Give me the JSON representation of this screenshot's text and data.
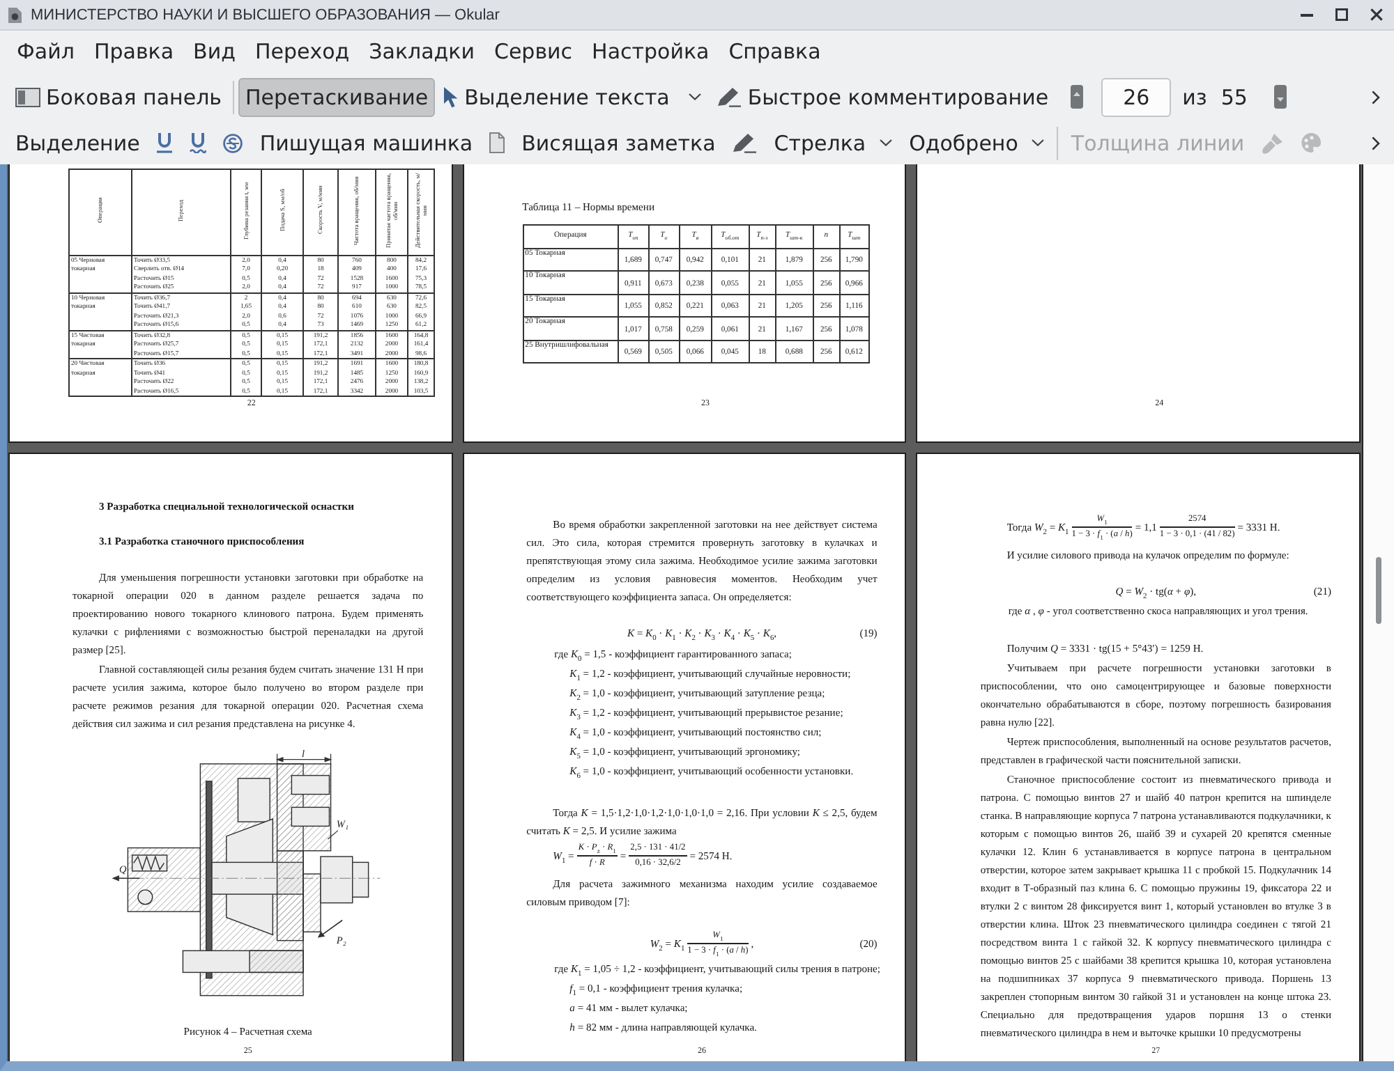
{
  "window": {
    "title": "МИНИСТЕРСТВО НАУКИ И ВЫСШЕГО ОБРАЗОВАНИЯ — Okular"
  },
  "menu": [
    "Файл",
    "Правка",
    "Вид",
    "Переход",
    "Закладки",
    "Сервис",
    "Настройка",
    "Справка"
  ],
  "main_toolbar": {
    "items": [
      {
        "kind": "icon-text",
        "label": "Боковая панель",
        "selected": false
      },
      {
        "kind": "separator"
      },
      {
        "kind": "text",
        "label": "Перетаскивание",
        "selected": true
      },
      {
        "kind": "icon-dropdown",
        "label": "Выделение текста",
        "selected": false
      },
      {
        "kind": "icon-text",
        "label": "Быстрое комментирование",
        "selected": false
      }
    ],
    "page_field": {
      "value": "26"
    },
    "page_of": "из",
    "page_total": "55"
  },
  "annotation_toolbar": {
    "items": [
      {
        "kind": "text",
        "label": "Выделение",
        "disabled": false
      },
      {
        "kind": "icon",
        "disabled": false
      },
      {
        "kind": "icon",
        "disabled": false
      },
      {
        "kind": "icon",
        "disabled": false
      },
      {
        "kind": "text",
        "label": "Пишущая машинка",
        "disabled": false
      },
      {
        "kind": "icon",
        "disabled": false
      },
      {
        "kind": "text",
        "label": "Висящая заметка",
        "disabled": false
      },
      {
        "kind": "icon",
        "disabled": false
      },
      {
        "kind": "dropdown",
        "label": "Стрелка",
        "disabled": false
      },
      {
        "kind": "dropdown",
        "label": "Одобрено",
        "disabled": false
      },
      {
        "kind": "separator"
      },
      {
        "kind": "text",
        "label": "Толщина линии",
        "disabled": true
      },
      {
        "kind": "icon",
        "disabled": true
      },
      {
        "kind": "icon",
        "disabled": true
      }
    ]
  },
  "pages": [
    {
      "number": "22",
      "blocks": [
        {
          "kind": "rotated-table",
          "columns": [
            "Операция",
            "Переход",
            "Глубина резания t, мм",
            "Подача S, мм/об",
            "Скорость V, м/мин",
            "Частота вращения, об/мин",
            "Принятая частота вращения, об/мин",
            "Действительная скорость, м/мин"
          ],
          "rows": [
            {
              "cells": [
                [
                  "05 Черновая токарная"
                ],
                [
                  "Точить Ø33,5",
                  "Сверлить отв. Ø14",
                  "Расточить Ø15",
                  "Расточить Ø25"
                ],
                [
                  "2,0",
                  "7,0",
                  "0,5",
                  "2,0"
                ],
                [
                  "0,4",
                  "0,20",
                  "0,4",
                  "0,4"
                ],
                [
                  "80",
                  "18",
                  "72",
                  "72"
                ],
                [
                  "760",
                  "409",
                  "1528",
                  "917"
                ],
                [
                  "800",
                  "400",
                  "1600",
                  "1000"
                ],
                [
                  "84,2",
                  "17,6",
                  "75,3",
                  "78,5"
                ]
              ]
            },
            {
              "cells": [
                [
                  "10 Черновая токарная"
                ],
                [
                  "Точить Ø36,7",
                  "Точить Ø41,7",
                  "Расточить Ø21,3",
                  "Расточить Ø15,6"
                ],
                [
                  "2",
                  "1,65",
                  "2,0",
                  "0,5"
                ],
                [
                  "0,4",
                  "0,4",
                  "0,6",
                  "0,4"
                ],
                [
                  "80",
                  "80",
                  "72",
                  "73"
                ],
                [
                  "694",
                  "610",
                  "1076",
                  "1469"
                ],
                [
                  "630",
                  "630",
                  "1000",
                  "1250"
                ],
                [
                  "72,6",
                  "82,5",
                  "66,9",
                  "61,2"
                ]
              ]
            },
            {
              "cells": [
                [
                  "15 Чистовая токарная"
                ],
                [
                  "Точить Ø32,8",
                  "Расточить Ø25,7",
                  "Расточить Ø15,7"
                ],
                [
                  "0,5",
                  "0,5",
                  "0,5"
                ],
                [
                  "0,15",
                  "0,15",
                  "0,15"
                ],
                [
                  "191,2",
                  "172,1",
                  "172,1"
                ],
                [
                  "1856",
                  "2132",
                  "3491"
                ],
                [
                  "1600",
                  "2000",
                  "2000"
                ],
                [
                  "164,8",
                  "161,4",
                  "98,6"
                ]
              ]
            },
            {
              "cells": [
                [
                  "20 Чистовая токарная"
                ],
                [
                  "Точить Ø36",
                  "Точить Ø41",
                  "Расточить Ø22",
                  "Расточить Ø16,5"
                ],
                [
                  "0,5",
                  "0,5",
                  "0,5",
                  "0,5"
                ],
                [
                  "0,15",
                  "0,15",
                  "0,15",
                  "0,15"
                ],
                [
                  "191,2",
                  "191,2",
                  "172,1",
                  "172,1"
                ],
                [
                  "1691",
                  "1485",
                  "2476",
                  "3342"
                ],
                [
                  "1600",
                  "1250",
                  "2000",
                  "2000"
                ],
                [
                  "180,8",
                  "160,9",
                  "138,2",
                  "103,5"
                ]
              ]
            }
          ]
        }
      ]
    },
    {
      "number": "23",
      "blocks": [
        {
          "kind": "table-title",
          "text": "Таблица 11 – Нормы времени"
        },
        {
          "kind": "table",
          "columns": [
            "Операция",
            "T$_{оп}$",
            "T$_{о}$",
            "T$_{в}$",
            "T$_{об.от}$",
            "T$_{п-з}$",
            "T$_{шт-к}$",
            "n",
            "T$_{шт}$"
          ],
          "rows": [
            [
              "05 Токарная",
              "1,689",
              "0,747",
              "0,942",
              "0,101",
              "21",
              "1,879",
              "256",
              "1,790"
            ],
            [
              "10 Токарная",
              "0,911",
              "0,673",
              "0,238",
              "0,055",
              "21",
              "1,055",
              "256",
              "0,966"
            ],
            [
              "15 Токарная",
              "1,055",
              "0,852",
              "0,221",
              "0,063",
              "21",
              "1,205",
              "256",
              "1,116"
            ],
            [
              "20 Токарная",
              "1,017",
              "0,758",
              "0,259",
              "0,061",
              "21",
              "1,167",
              "256",
              "1,078"
            ],
            [
              "25 Внутришлифовальная",
              "0,569",
              "0,505",
              "0,066",
              "0,045",
              "18",
              "0,688",
              "256",
              "0,612"
            ]
          ]
        }
      ]
    },
    {
      "number": "24"
    },
    {
      "number": "25",
      "blocks": [
        {
          "kind": "heading",
          "text": "3 Разработка специальной технологической оснастки"
        },
        {
          "kind": "heading",
          "text": "3.1 Разработка станочного приспособления"
        },
        {
          "kind": "paragraph",
          "text": "Для уменьшения погрешности установки заготовки при обработке на токарной операции 020 в данном разделе решается задача по проектированию нового токарного клинового патрона. Будем применять кулачки с рифлениями с возможностью быстрой переналадки на другой размер [25]."
        },
        {
          "kind": "paragraph",
          "text": "Главной составляющей силы резания будем считать значение 131 Н при расчете усилия зажима, которое было получено во втором разделе при расчете режимов резания для токарной операции 020. Расчетная схема действия сил зажима и сил резания представлена на рисунке 4."
        },
        {
          "kind": "figure",
          "labels": [
            "l",
            "W₁",
            "Q",
            "P₂"
          ]
        },
        {
          "kind": "caption",
          "text": "Рисунок 4 – Расчетная схема"
        }
      ]
    },
    {
      "number": "26",
      "blocks": [
        {
          "kind": "paragraph",
          "text": "Во время обработки закрепленной заготовки на нее действует система сил. Это сила, которая стремится провернуть заготовку в кулачках и препятствующая этому сила зажима. Необходимое усилие зажима заготовки определим из условия равновесия моментов. Необходим учет соответствующего коэффициента запаса. Он определяется:"
        },
        {
          "kind": "formula",
          "parts": [
            {
              "kind": "text",
              "text": "*K* = *K*$_{0}$ · *K*$_{1}$ · *K*$_{2}$ · *K*$_{3}$ · *K*$_{4}$ · *K*$_{5}$ · *K*$_{6}$,"
            }
          ],
          "number": "(19)"
        },
        {
          "kind": "where",
          "text": "где *K*$_{0}$ = 1,5 - коэффициент гарантированного запаса;"
        },
        {
          "kind": "item",
          "text": "*K*$_{1}$ = 1,2 - коэффициент, учитывающий случайные неровности;"
        },
        {
          "kind": "item",
          "text": "*K*$_{2}$ = 1,0 - коэффициент, учитывающий затупление резца;"
        },
        {
          "kind": "item",
          "text": "*K*$_{3}$ = 1,2 - коэффициент, учитывающий прерывистое резание;"
        },
        {
          "kind": "item",
          "text": "*K*$_{4}$ = 1,0 - коэффициент, учитывающий постоянство сил;"
        },
        {
          "kind": "item",
          "text": "*K*$_{5}$ = 1,0 - коэффициент, учитывающий эргономику;"
        },
        {
          "kind": "item",
          "text": "*K*$_{6}$ = 1,0 - коэффициент, учитывающий особенности установки."
        },
        {
          "kind": "paragraph",
          "text": "Тогда *K* = 1,5·1,2·1,0·1,2·1,0·1,0·1,0 = 2,16. При условии *K* ≤ 2,5, будем считать *K* = 2,5. И усилие зажима"
        },
        {
          "kind": "formula-line",
          "parts": [
            {
              "kind": "text",
              "text": "*W*$_{1}$ ="
            },
            {
              "kind": "fraction",
              "num": "*K* · *P*$_{z}$ · *R*$_{1}$",
              "den": "*f* · *R*"
            },
            {
              "kind": "text",
              "text": "="
            },
            {
              "kind": "fraction",
              "num": "2,5 · 131 · 41/2",
              "den": "0,16 · 32,6/2"
            },
            {
              "kind": "text",
              "text": "= 2574 Н."
            }
          ]
        },
        {
          "kind": "paragraph",
          "text": "Для расчета зажимного механизма находим усилие создаваемое силовым приводом [7]:"
        },
        {
          "kind": "formula",
          "parts": [
            {
              "kind": "text",
              "text": "*W*$_{2}$ = *K*$_{1}$"
            },
            {
              "kind": "fraction",
              "num": "*W*$_{1}$",
              "den": "1 − 3 · *f*$_{1}$ · (*a* / *h*)"
            },
            {
              "kind": "text",
              "text": ","
            }
          ],
          "number": "(20)"
        },
        {
          "kind": "where",
          "text": "где *K*$_{1}$ = 1,05 ÷ 1,2 - коэффициент, учитывающий силы трения в патроне;"
        },
        {
          "kind": "item",
          "text": "*f*$_{1}$ = 0,1 - коэффициент трения кулачка;"
        },
        {
          "kind": "item",
          "text": "*a* = 41 мм - вылет кулачка;"
        },
        {
          "kind": "item",
          "text": "*h* = 82 мм - длина направляющей кулачка."
        }
      ]
    },
    {
      "number": "27",
      "blocks": [
        {
          "kind": "formula-line",
          "parts": [
            {
              "kind": "text",
              "text": "Тогда *W*$_{2}$ = *K*$_{1}$"
            },
            {
              "kind": "fraction",
              "num": "*W*$_{1}$",
              "den": "1 − 3 · *f*$_{1}$ · (*a* / *h*)"
            },
            {
              "kind": "text",
              "text": "= 1,1"
            },
            {
              "kind": "fraction",
              "num": "2574",
              "den": "1 − 3 · 0,1 · (41 / 82)"
            },
            {
              "kind": "text",
              "text": "= 3331 Н."
            }
          ]
        },
        {
          "kind": "paragraph",
          "text": "И усилие силового привода на кулачок определим по формуле:"
        },
        {
          "kind": "formula",
          "parts": [
            {
              "kind": "text",
              "text": "*Q* = *W*$_{2}$ · tg(*α* + *φ*),"
            }
          ],
          "number": "(21)"
        },
        {
          "kind": "where",
          "text": "где *α* , *φ* - угол соответственно скоса направляющих и угол трения."
        },
        {
          "kind": "paragraph",
          "text": "Получим *Q* = 3331 · tg(15 + 5°43′) = 1259 Н."
        },
        {
          "kind": "paragraph",
          "text": "Учитываем при расчете погрешности установки заготовки в приспособлении, что оно самоцентрирующее и базовые поверхности окончательно обрабатываются в сборе, поэтому погрешность базирования равна нулю [22]."
        },
        {
          "kind": "paragraph",
          "text": "Чертеж приспособления, выполненный на основе результатов расчетов, представлен в графической части пояснительной записки."
        },
        {
          "kind": "paragraph",
          "text": "Станочное приспособление состоит из пневматического привода и патрона. С помощью винтов 27 и шайб 40 патрон крепится на шпинделе станка. В направляющие корпуса 7 патрона устанавливаются подкулачники, к которым с помощью винтов 26, шайб 39 и сухарей 20 крепятся сменные кулачки 12. Клин 6 устанавливается в корпусе патрона в центральном отверстии, которое затем закрывает крышка 11 с пробкой 15. Подкулачник 14 входит в Т-образный паз клина 6. С помощью пружины 19, фиксатора 22 и втулки 2 с винтом 28 фиксируется винт 1, который установлен во втулке 3 в отверстии клина. Шток 23 пневматического цилиндра соединен с тягой 21 посредством винта 1 с гайкой 32. К корпусу пневматического цилиндра с помощью винтов 25 с шайбами 38 крепится крышка 10, которая установлена на подшипниках 37 корпуса 9 пневматического привода. Поршень 13 закреплен стопорным винтом 30 гайкой 31 и установлен на конце штока 23. Специально для предотвращения ударов поршня 13 о стенки пневматического цилиндра в нем и выточке крышки 10 предусмотрены"
        }
      ]
    }
  ]
}
